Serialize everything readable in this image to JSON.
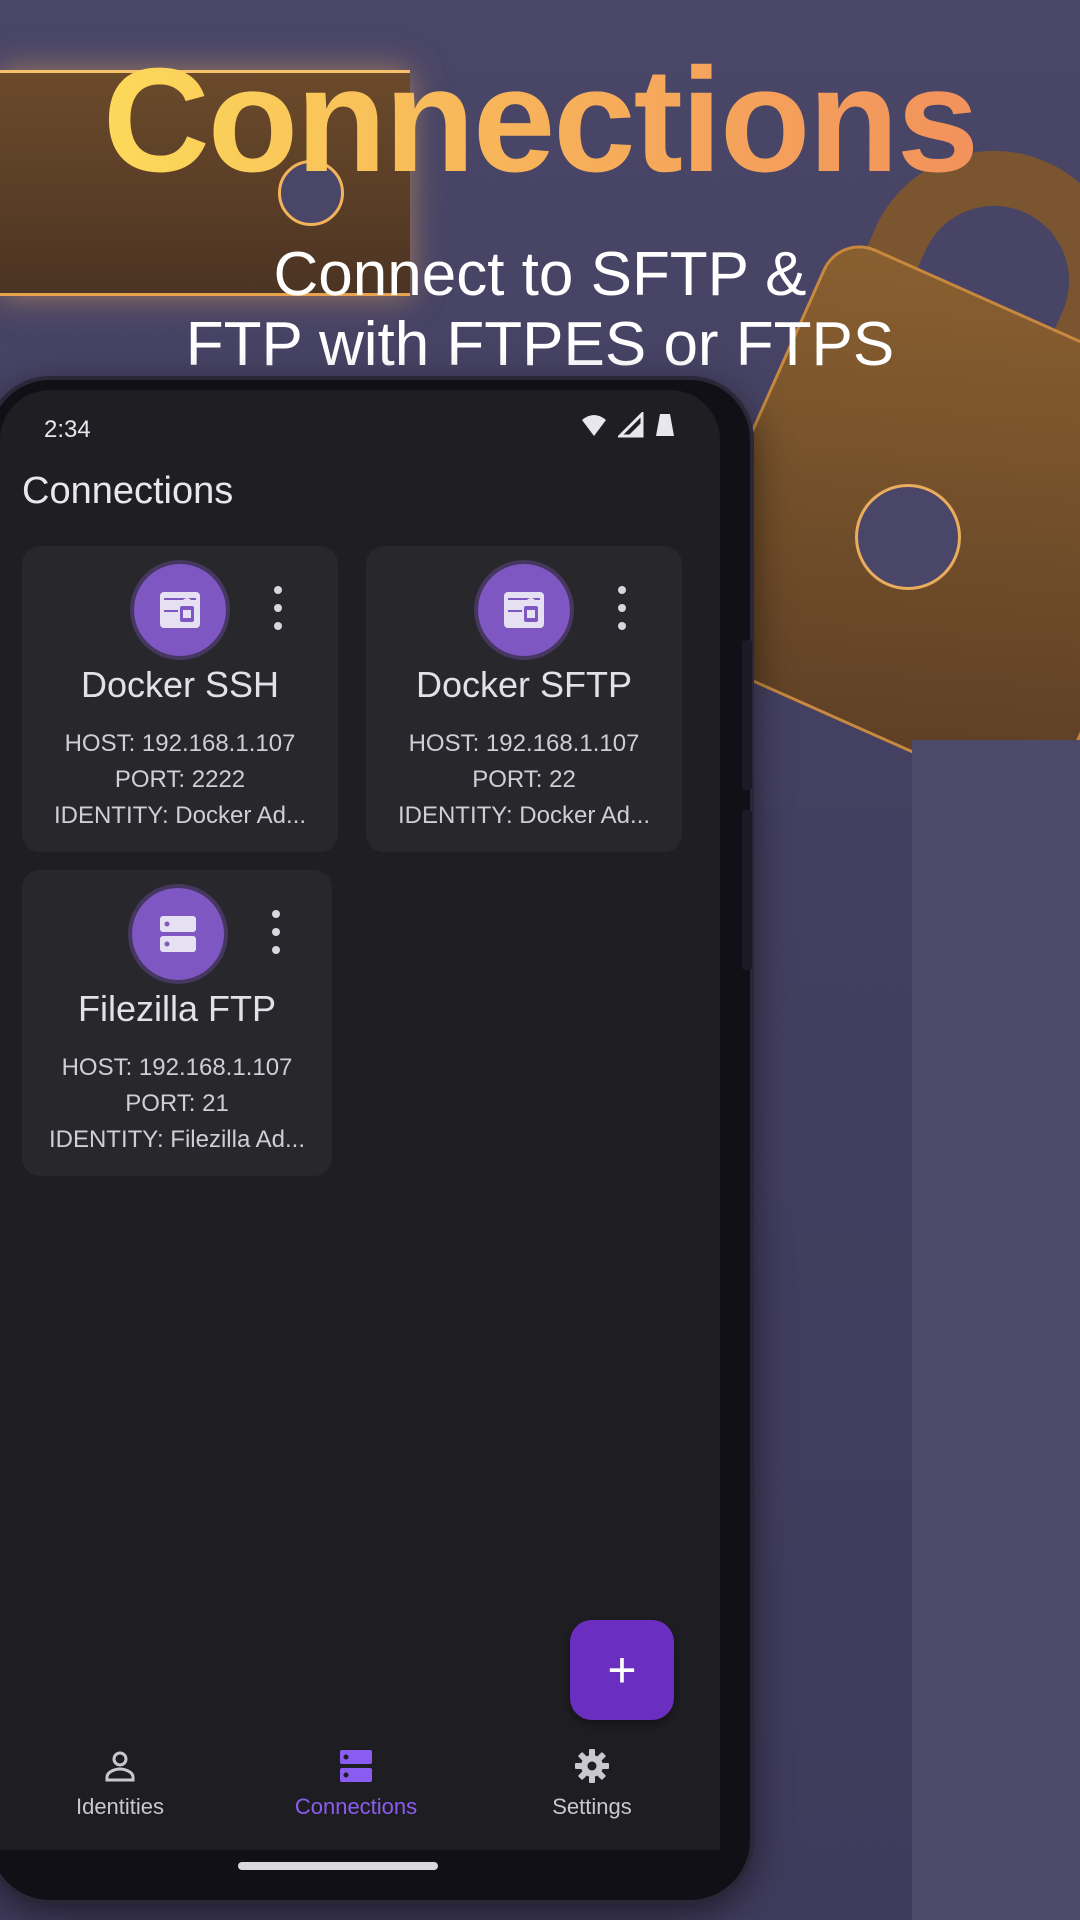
{
  "hero": {
    "title": "Connections",
    "subtitle_line1": "Connect to SFTP &",
    "subtitle_line2": "FTP with FTPES or FTPS"
  },
  "status_bar": {
    "time": "2:34",
    "icons": [
      "wifi-icon",
      "signal-icon",
      "battery-icon"
    ]
  },
  "app": {
    "title": "Connections",
    "accent_color": "#7e57c2",
    "connections": [
      {
        "name": "Docker SSH",
        "host": "HOST: 192.168.1.107",
        "port": "PORT: 2222",
        "identity": "IDENTITY: Docker Ad...",
        "icon": "lock-folder-icon"
      },
      {
        "name": "Docker SFTP",
        "host": "HOST: 192.168.1.107",
        "port": "PORT: 22",
        "identity": "IDENTITY: Docker Ad...",
        "icon": "lock-folder-icon"
      },
      {
        "name": "Filezilla FTP",
        "host": "HOST: 192.168.1.107",
        "port": "PORT: 21",
        "identity": "IDENTITY: Filezilla Ad...",
        "icon": "server-icon"
      }
    ],
    "fab_label": "+",
    "nav": [
      {
        "label": "Identities",
        "icon": "person-icon",
        "active": false
      },
      {
        "label": "Connections",
        "icon": "server-icon",
        "active": true
      },
      {
        "label": "Settings",
        "icon": "gear-icon",
        "active": false
      }
    ]
  }
}
